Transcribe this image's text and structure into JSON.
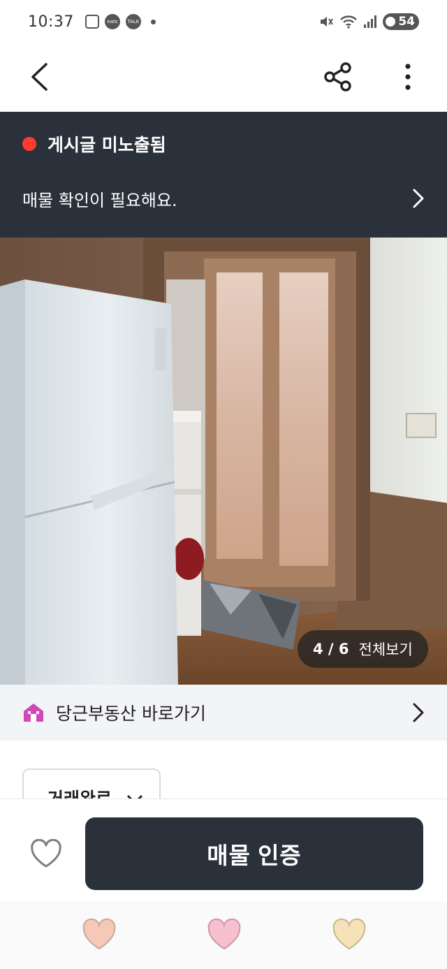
{
  "status_bar": {
    "time": "10:37",
    "icons": [
      "screenshot-icon",
      "coupang-eats-icon",
      "kakaotalk-icon",
      "notification-dot"
    ],
    "eats_label": "eats",
    "talk_label": "TALK",
    "right_icons": [
      "mute-icon",
      "wifi-icon",
      "signal-icon"
    ],
    "battery": "54"
  },
  "app_bar": {
    "back_icon": "chevron-left-icon",
    "share_icon": "share-icon",
    "more_icon": "more-vertical-icon"
  },
  "notice": {
    "status_color": "#ff3b30",
    "title": "게시글 미노출됨",
    "message": "매물 확인이 필요해요."
  },
  "photo": {
    "counter_index": "4 / 6",
    "counter_action": "전체보기"
  },
  "shortcut": {
    "icon": "house-icon",
    "label": "당근부동산 바로가기"
  },
  "status_select": {
    "label": "거래완료"
  },
  "bottom_bar": {
    "favorite_icon": "heart-outline-icon",
    "cta_label": "매물 인증",
    "accent": "#2b313b"
  },
  "reactions": [
    {
      "name": "heart-peach-icon",
      "color": "#f5c8b8"
    },
    {
      "name": "heart-pink-icon",
      "color": "#f7bfcf"
    },
    {
      "name": "heart-yellow-icon",
      "color": "#f6e2b8"
    }
  ]
}
